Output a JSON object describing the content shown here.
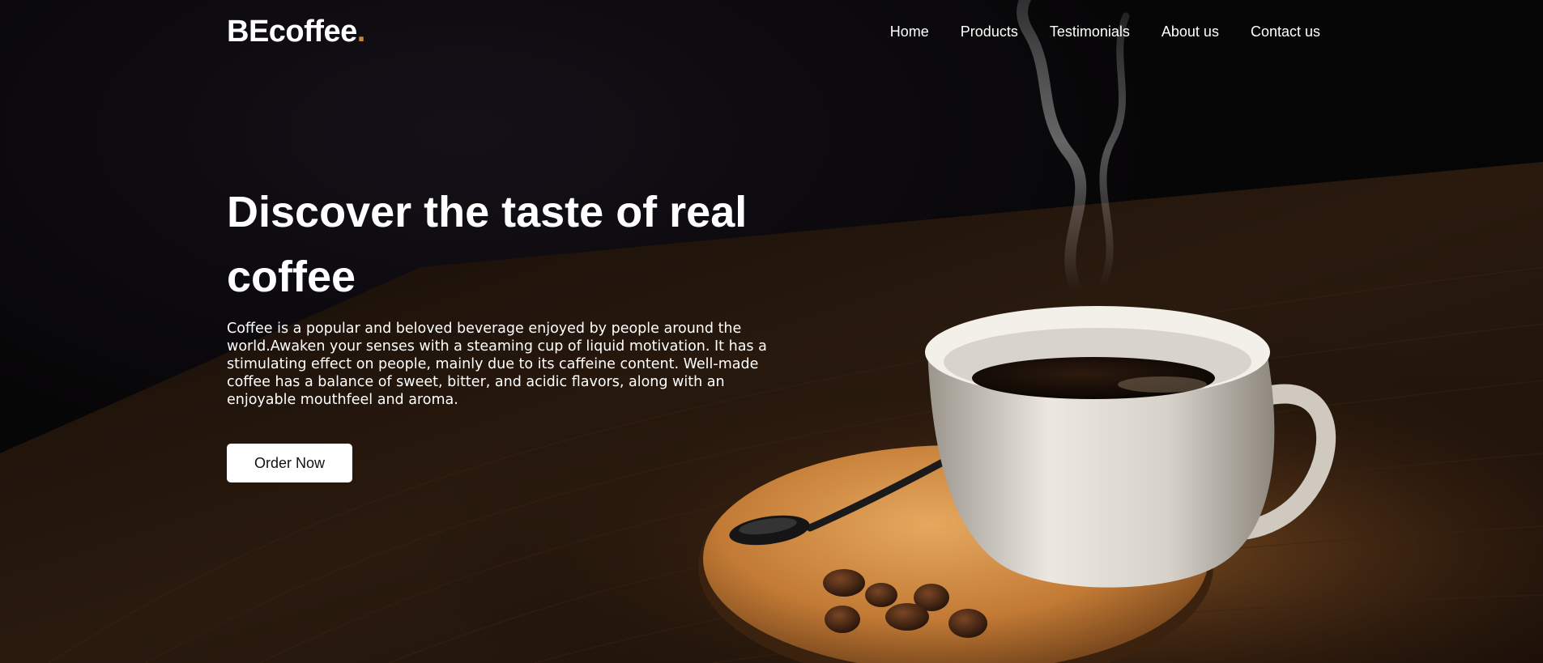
{
  "brand": {
    "name": "BEcoffee",
    "dot": ".",
    "accent_color": "#c9853c"
  },
  "nav": {
    "items": [
      {
        "label": "Home"
      },
      {
        "label": "Products"
      },
      {
        "label": "Testimonials"
      },
      {
        "label": "About us"
      },
      {
        "label": "Contact us"
      }
    ]
  },
  "hero": {
    "headline": "Discover the taste of real coffee",
    "description": "Coffee is a popular and beloved beverage enjoyed by people around the world.Awaken your senses with a steaming cup of liquid motivation. It has a stimulating effect on people, mainly due to its caffeine content. Well-made coffee has a balance of sweet, bitter, and acidic flavors, along with an enjoyable mouthfeel and aroma.",
    "cta_label": "Order Now"
  }
}
